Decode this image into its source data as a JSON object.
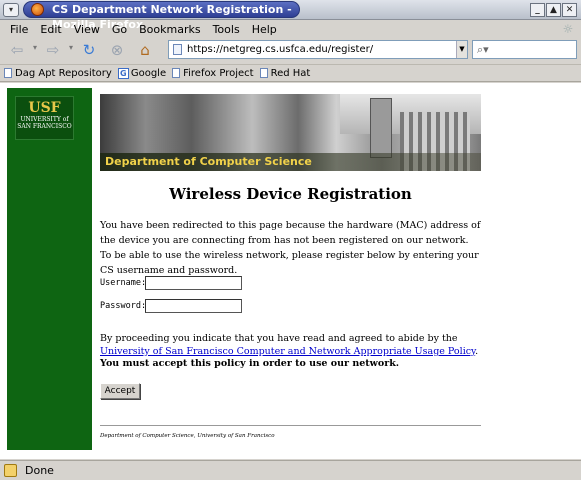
{
  "window": {
    "title": "CS Department Network Registration - Mozilla Firefox",
    "controls": [
      "_",
      "▲",
      "✕"
    ]
  },
  "menu": [
    "File",
    "Edit",
    "View",
    "Go",
    "Bookmarks",
    "Tools",
    "Help"
  ],
  "nav": {
    "url": "https://netgreg.cs.usfca.edu/register/",
    "search_placeholder": ""
  },
  "bookmarks": [
    "Dag Apt Repository",
    "Google",
    "Firefox Project",
    "Red Hat"
  ],
  "page": {
    "logo": {
      "mark": "USF",
      "line1": "UNIVERSITY of",
      "line2": "SAN FRANCISCO"
    },
    "banner_title": "Department of Computer Science",
    "title": "Wireless Device Registration",
    "intro": "You have been redirected to this page because the hardware (MAC) address of the device you are connecting from has not been registered on our network. To be able to use the wireless network, please register below by entering your CS username and password.",
    "username_label": "Username:",
    "password_label": "Password:",
    "username_value": "",
    "password_value": "",
    "agree_prefix": "By proceeding you indicate that you have read and agreed to abide by the ",
    "agree_link": "University of San Francisco Computer and Network Appropriate Usage Policy",
    "agree_suffix": ".",
    "must_accept": "You must accept this policy in order to use our network.",
    "accept_button": "Accept",
    "footer": "Department of Computer Science, University of San Francisco"
  },
  "status": {
    "text": "Done"
  },
  "colors": {
    "sidebar": "#0e6512",
    "banner_text": "#f1d24a",
    "link": "#0000cc"
  }
}
